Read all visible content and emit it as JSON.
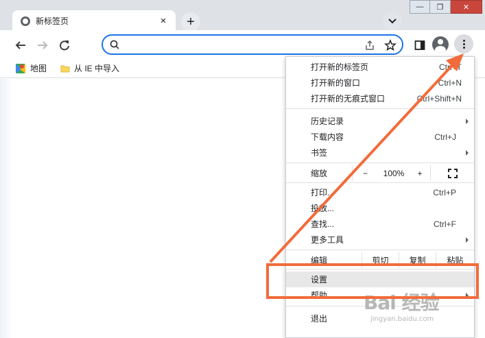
{
  "window": {
    "minimize_glyph": "—",
    "restore_glyph": "❐",
    "close_glyph": "✕"
  },
  "tab": {
    "title": "新标签页",
    "close_glyph": "×",
    "favicon": "chrome-icon"
  },
  "newtab_glyph": "+",
  "toolbar": {
    "back_icon": "arrow-left-icon",
    "forward_icon": "arrow-right-icon",
    "reload_icon": "reload-icon",
    "address_value": ""
  },
  "bookmarks": [
    {
      "label": "地图",
      "icon": "maps-icon"
    },
    {
      "label": "从 IE 中导入",
      "icon": "folder-icon"
    }
  ],
  "menu": {
    "group1": [
      {
        "label": "打开新的标签页",
        "shortcut": "Ctrl+T"
      },
      {
        "label": "打开新的窗口",
        "shortcut": "Ctrl+N"
      },
      {
        "label": "打开新的无痕式窗口",
        "shortcut": "Ctrl+Shift+N"
      }
    ],
    "group2": [
      {
        "label": "历史记录",
        "shortcut": "",
        "submenu": true
      },
      {
        "label": "下载内容",
        "shortcut": "Ctrl+J",
        "submenu": false
      },
      {
        "label": "书签",
        "shortcut": "",
        "submenu": true
      }
    ],
    "zoom": {
      "label": "缩放",
      "minus": "−",
      "value": "100%",
      "plus": "+"
    },
    "group3": [
      {
        "label": "打印...",
        "shortcut": "Ctrl+P",
        "submenu": false
      },
      {
        "label": "投放...",
        "shortcut": "",
        "submenu": false
      },
      {
        "label": "查找...",
        "shortcut": "Ctrl+F",
        "submenu": false
      },
      {
        "label": "更多工具",
        "shortcut": "",
        "submenu": true
      }
    ],
    "edit": {
      "label": "编辑",
      "cut": "剪切",
      "copy": "复制",
      "paste": "粘贴"
    },
    "settings": "设置",
    "help": "帮助",
    "exit": "退出"
  },
  "annotation": {
    "color": "#f26b3a"
  },
  "watermark": {
    "main": "Bai 经验",
    "sub": "jingyan.baidu.com"
  },
  "colors": {
    "accent": "#1a73e8",
    "tab_strip": "#dee1e6",
    "highlight": "#e8e8e8"
  }
}
